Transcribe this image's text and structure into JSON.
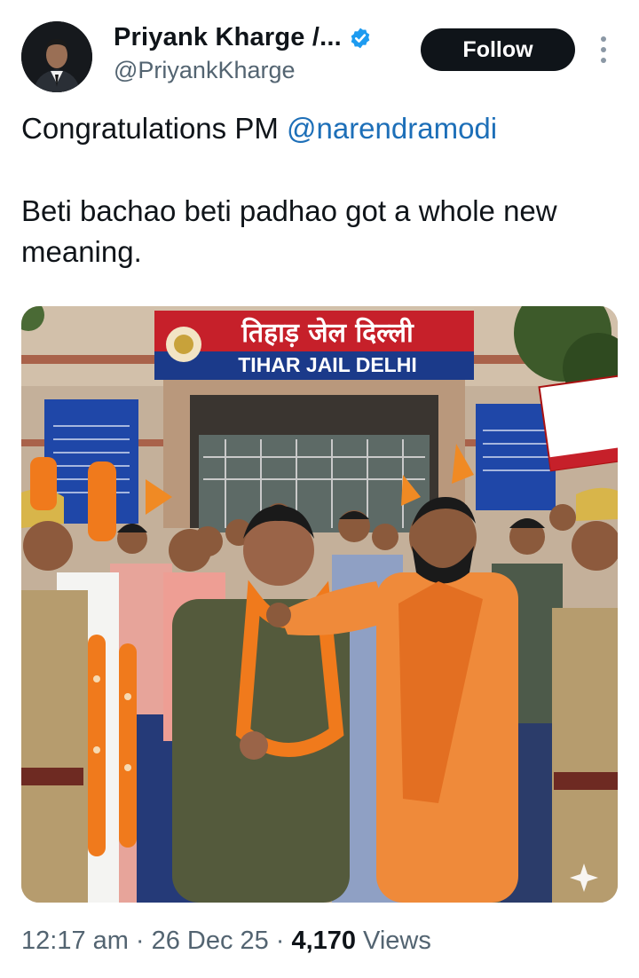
{
  "author": {
    "name": "Priyank Kharge /...",
    "handle": "@PriyankKharge",
    "verified": true
  },
  "follow_label": "Follow",
  "tweet": {
    "prefix": "Congratulations PM ",
    "mention": "@narendramodi",
    "line2": "Beti bachao beti padhao got a whole new meaning."
  },
  "image": {
    "sign_hindi": "तिहाड़ जेल दिल्ली",
    "sign_english": "TIHAR JAIL DELHI"
  },
  "meta": {
    "time": "12:17 am",
    "date": "26 Dec 25",
    "views_count": "4,170",
    "views_label": "Views"
  },
  "colors": {
    "link": "#1d6fb8",
    "verified": "#1d9bf0",
    "follow_bg": "#0f1419"
  }
}
